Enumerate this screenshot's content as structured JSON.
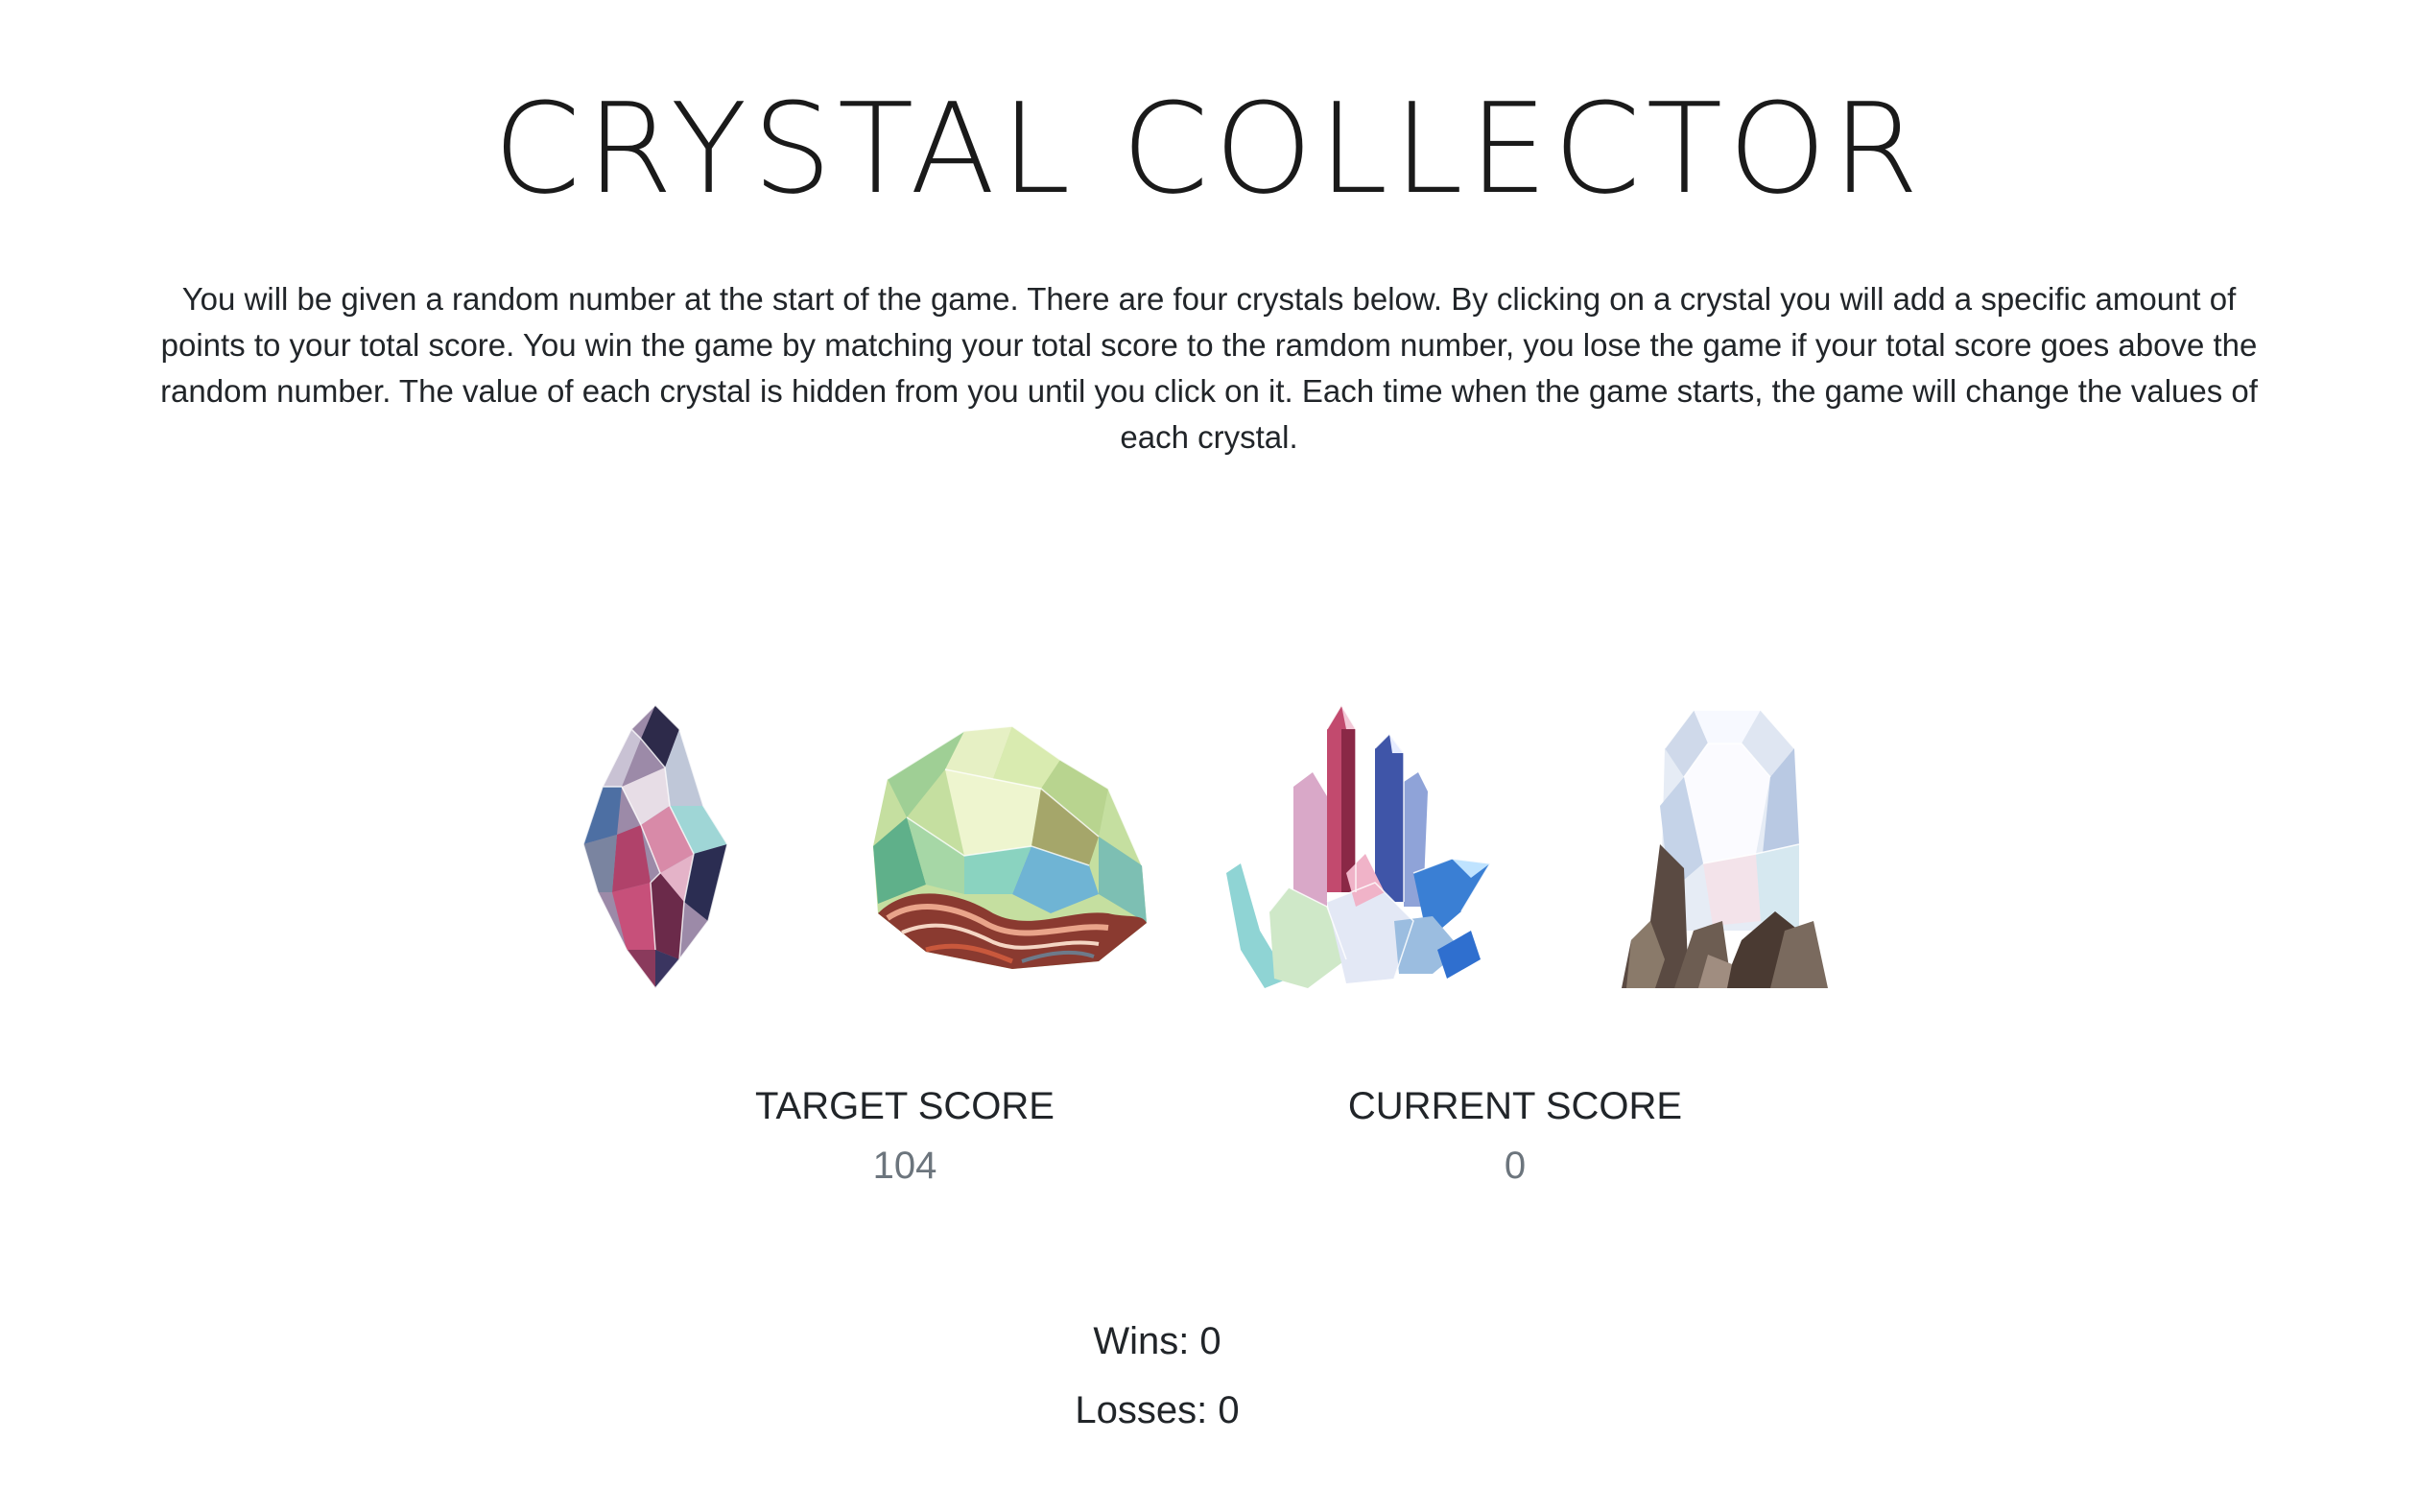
{
  "title": "CRYSTAL COLLECTOR",
  "instructions": "You will be given a random number at the start of the game. There are four crystals below. By clicking on a crystal you will add a specific amount of points to your total score. You win the game by matching your total score to the ramdom number, you lose the game if your total score goes above the random number. The value of each crystal is hidden from you until you click on it. Each time when the game starts, the game will change the values of each crystal.",
  "crystals": [
    {
      "icon": "purple-crystal-icon"
    },
    {
      "icon": "green-geode-icon"
    },
    {
      "icon": "pink-blue-crystal-cluster-icon"
    },
    {
      "icon": "clear-quartz-crystal-icon"
    }
  ],
  "target": {
    "label": "TARGET SCORE",
    "value": "104"
  },
  "current": {
    "label": "CURRENT SCORE",
    "value": "0"
  },
  "wins": "Wins: 0",
  "losses": "Losses: 0"
}
